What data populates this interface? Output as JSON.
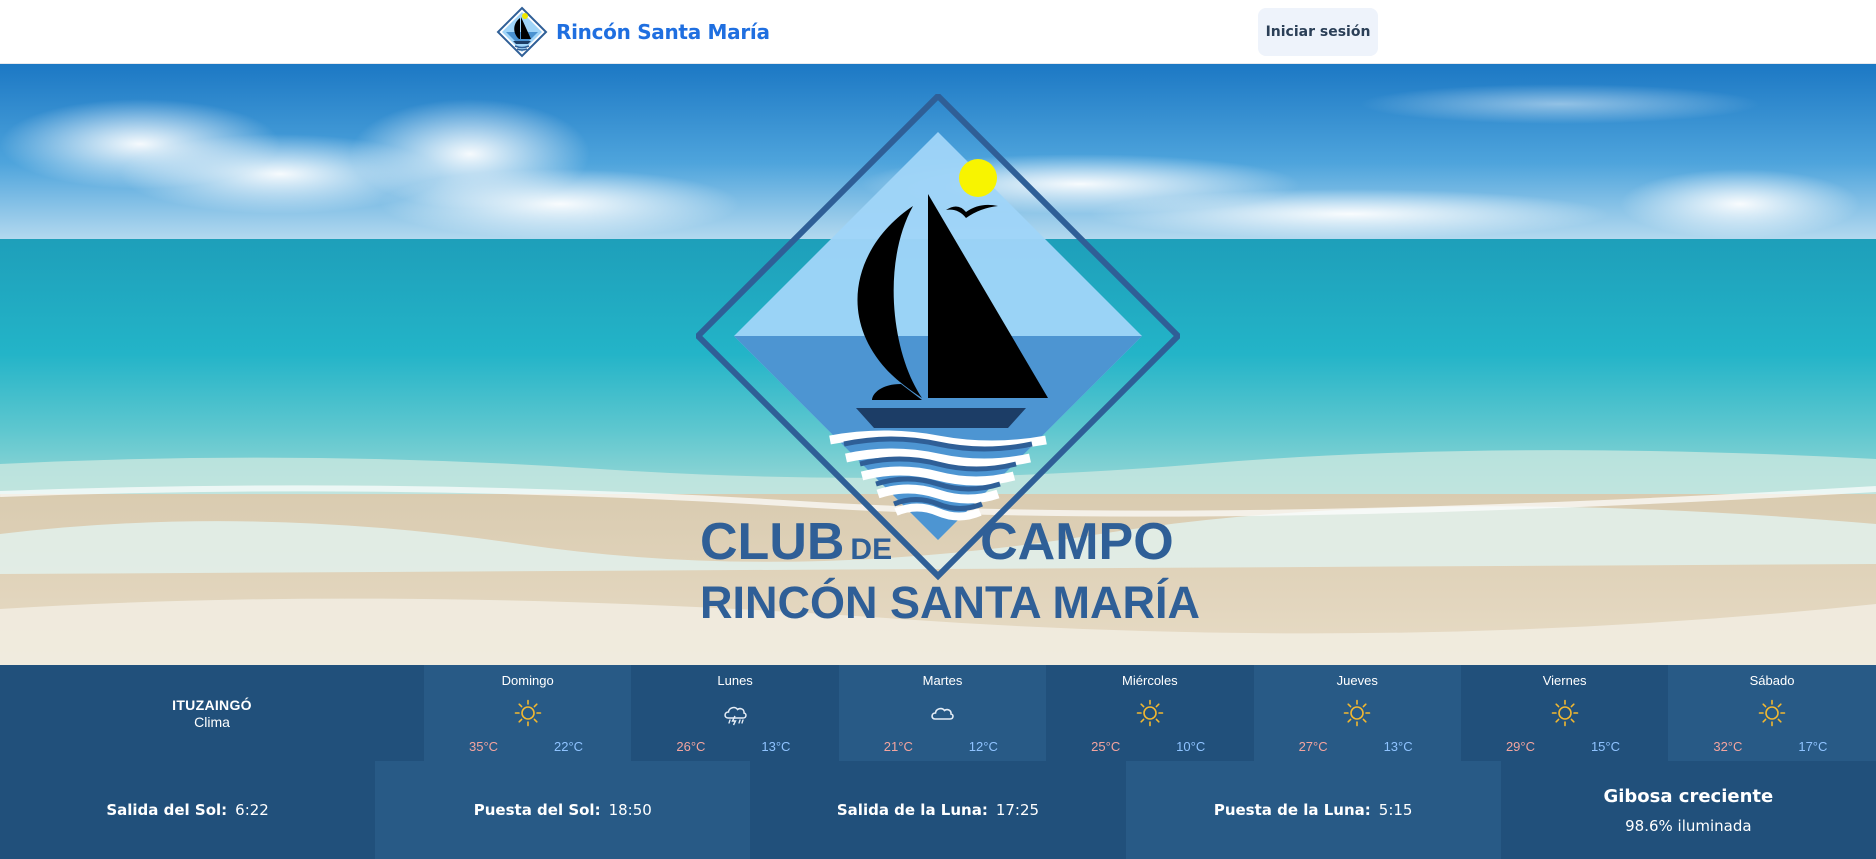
{
  "navbar": {
    "brand_name": "Rincón Santa María",
    "login_label": "Iniciar sesión",
    "brand_color": "#1f6fe0"
  },
  "hero": {
    "logo_line1_a": "CLUB",
    "logo_line1_b": "DE",
    "logo_line1_c": "CAMPO",
    "logo_line2": "RINCÓN SANTA MARÍA",
    "logo_text_color": "#2f5f97"
  },
  "weather": {
    "location": "ITUZAINGÓ",
    "subtitle": "Clima",
    "days": [
      {
        "name": "Domingo",
        "icon": "sun-icon",
        "high": "35°C",
        "low": "22°C"
      },
      {
        "name": "Lunes",
        "icon": "thunderstorm-icon",
        "high": "26°C",
        "low": "13°C"
      },
      {
        "name": "Martes",
        "icon": "cloud-icon",
        "high": "21°C",
        "low": "12°C"
      },
      {
        "name": "Miércoles",
        "icon": "sun-icon",
        "high": "25°C",
        "low": "10°C"
      },
      {
        "name": "Jueves",
        "icon": "sun-icon",
        "high": "27°C",
        "low": "13°C"
      },
      {
        "name": "Viernes",
        "icon": "sun-icon",
        "high": "29°C",
        "low": "15°C"
      },
      {
        "name": "Sábado",
        "icon": "sun-icon",
        "high": "32°C",
        "low": "17°C"
      }
    ]
  },
  "astro": {
    "sunrise_label": "Salida del Sol:",
    "sunrise": "6:22",
    "sunset_label": "Puesta del Sol:",
    "sunset": "18:50",
    "moonrise_label": "Salida de la Luna:",
    "moonrise": "17:25",
    "moonset_label": "Puesta de la Luna:",
    "moonset": "5:15",
    "moon_phase": "Gibosa creciente",
    "moon_illumination": "98.6% iluminada"
  },
  "colors": {
    "weather_bg": "#21507b",
    "weather_bg_alt": "#285a86",
    "high_temp": "#f3a49f",
    "low_temp": "#8fc3ff",
    "sun_icon": "#f2b830"
  }
}
